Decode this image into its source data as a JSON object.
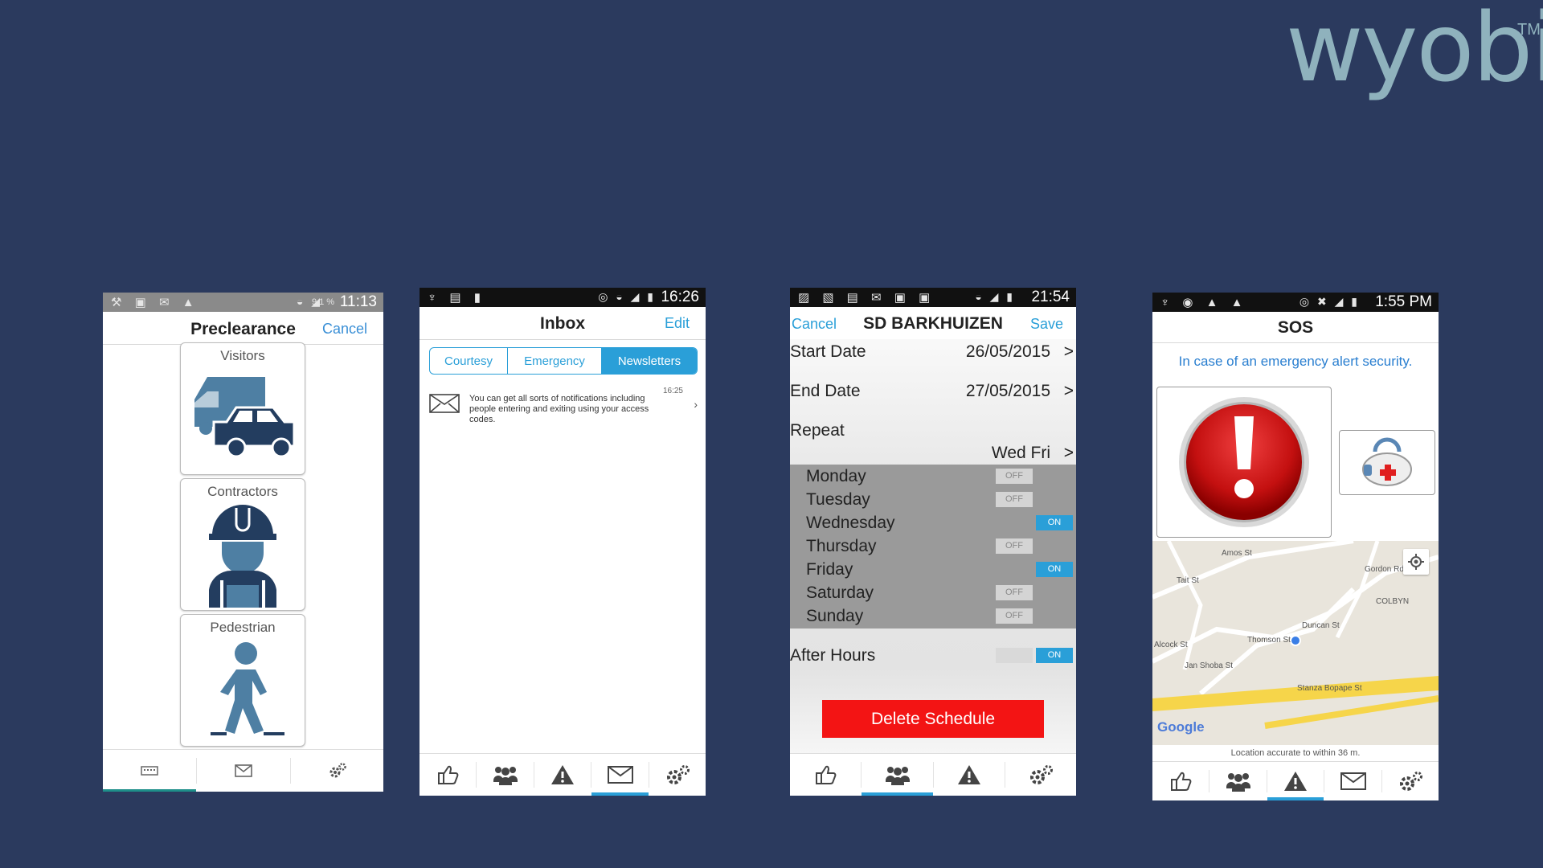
{
  "brand": {
    "logo_text": "wyobi",
    "trademark": "TM"
  },
  "preclearance": {
    "status_time": "11:13",
    "status_battery": "91%",
    "title": "Preclearance",
    "cancel_label": "Cancel",
    "cards": [
      {
        "label": "Visitors",
        "icon": "visitors-vehicles-icon"
      },
      {
        "label": "Contractors",
        "icon": "contractor-worker-icon"
      },
      {
        "label": "Pedestrian",
        "icon": "pedestrian-walking-icon"
      }
    ],
    "bottom_nav": [
      "keyboard-icon",
      "mail-icon",
      "settings-gears-icon"
    ],
    "active_tab_index": 0
  },
  "inbox": {
    "status_time": "16:26",
    "title": "Inbox",
    "edit_label": "Edit",
    "tabs": [
      "Courtesy",
      "Emergency",
      "Newsletters"
    ],
    "selected_tab": "Newsletters",
    "messages": [
      {
        "time": "16:25",
        "text": "You can get all sorts of notifications including people entering and exiting using your access codes."
      }
    ],
    "bottom_nav": [
      "thumbs-up-icon",
      "group-icon",
      "warning-icon",
      "mail-icon",
      "settings-gears-icon"
    ],
    "active_tab_index": 3
  },
  "schedule": {
    "status_time": "21:54",
    "cancel_label": "Cancel",
    "title": "SD BARKHUIZEN",
    "save_label": "Save",
    "start_date_label": "Start Date",
    "start_date": "26/05/2015",
    "end_date_label": "End Date",
    "end_date": "27/05/2015",
    "repeat_label": "Repeat",
    "repeat_value": "Wed Fri",
    "chevron": ">",
    "days": [
      {
        "name": "Monday",
        "state": "OFF"
      },
      {
        "name": "Tuesday",
        "state": "OFF"
      },
      {
        "name": "Wednesday",
        "state": "ON"
      },
      {
        "name": "Thursday",
        "state": "OFF"
      },
      {
        "name": "Friday",
        "state": "ON"
      },
      {
        "name": "Saturday",
        "state": "OFF"
      },
      {
        "name": "Sunday",
        "state": "OFF"
      }
    ],
    "after_hours_label": "After Hours",
    "after_hours_state": "ON",
    "delete_label": "Delete Schedule",
    "bottom_nav": [
      "thumbs-up-icon",
      "group-icon",
      "warning-icon",
      "settings-gears-icon"
    ],
    "active_tab_index": 1
  },
  "sos": {
    "status_time": "1:55 PM",
    "title": "SOS",
    "info": "In case of an emergency alert security.",
    "panic_icon": "red-exclamation-panic-icon",
    "medical_icon": "first-aid-kit-icon",
    "map": {
      "streets": [
        "Amos St",
        "Tait St",
        "Gordon Rd",
        "COLBYN",
        "Alcock St",
        "Thomson St",
        "Duncan St",
        "Jan Shoba St",
        "Stanza Bopape St"
      ],
      "provider": "Google"
    },
    "accuracy_text": "Location accurate to within 36 m.",
    "bottom_nav": [
      "thumbs-up-icon",
      "group-icon",
      "warning-icon",
      "mail-icon",
      "settings-gears-icon"
    ],
    "active_tab_index": 2
  },
  "colors": {
    "background": "#2b3a5e",
    "accent": "#2a9fd8",
    "danger": "#f31414",
    "logo": "#8fb2bd"
  }
}
